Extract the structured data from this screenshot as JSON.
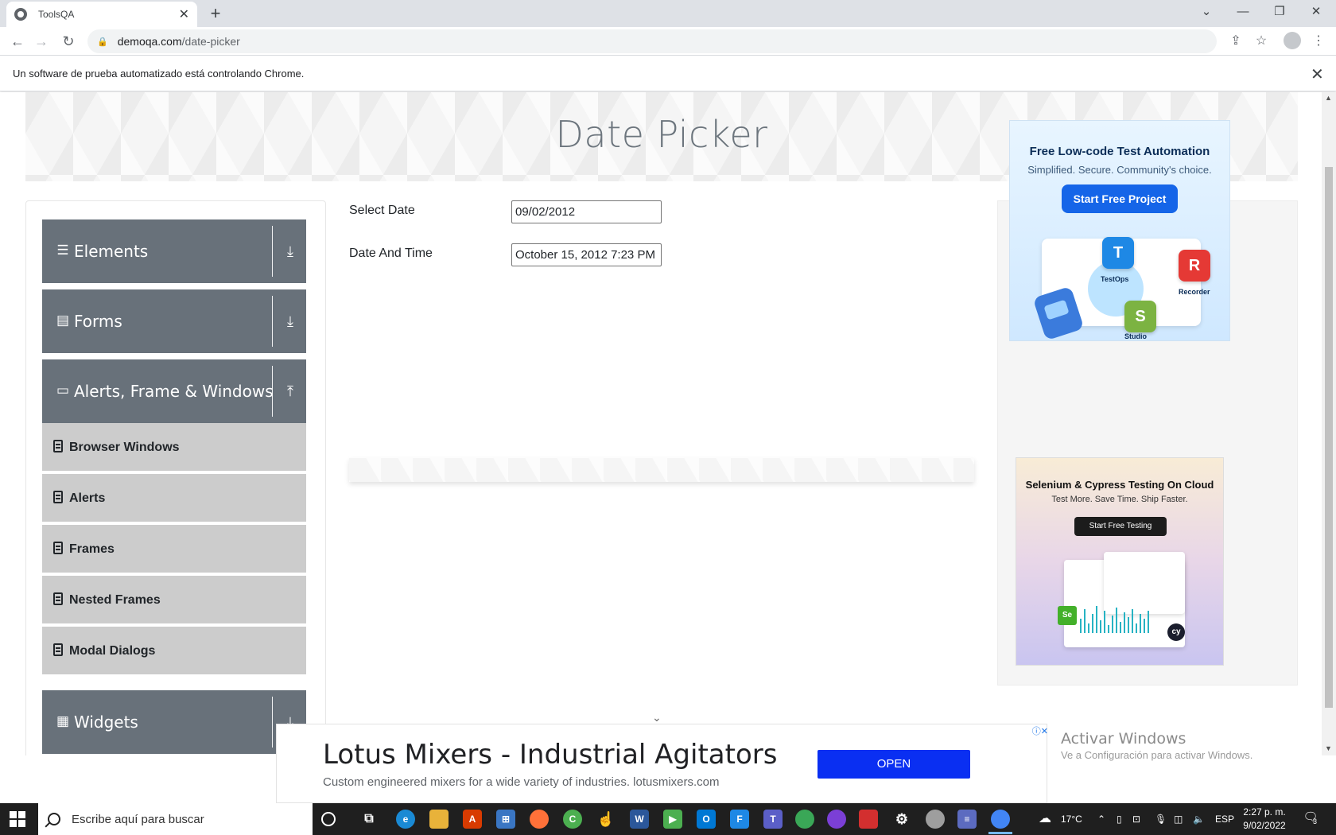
{
  "browser": {
    "tab_title": "ToolsQA",
    "url_host": "demoqa.com",
    "url_path": "/date-picker",
    "infobar_message": "Un software de prueba automatizado está controlando Chrome."
  },
  "page": {
    "title": "Date Picker",
    "sidebar": {
      "groups": [
        {
          "label": "Elements",
          "icon": "hamburger-icon",
          "state": "collapsed"
        },
        {
          "label": "Forms",
          "icon": "document-icon",
          "state": "collapsed"
        },
        {
          "label": "Alerts, Frame & Windows",
          "icon": "window-icon",
          "state": "expanded"
        },
        {
          "label": "Widgets",
          "icon": "grid-icon",
          "state": "collapsed"
        }
      ],
      "items": [
        {
          "label": "Browser Windows"
        },
        {
          "label": "Alerts"
        },
        {
          "label": "Frames"
        },
        {
          "label": "Nested Frames"
        },
        {
          "label": "Modal Dialogs"
        }
      ]
    },
    "form": {
      "select_date_label": "Select Date",
      "select_date_value": "09/02/2012",
      "date_time_label": "Date And Time",
      "date_time_value": "October 15, 2012 7:23 PM"
    },
    "ads": {
      "ad1": {
        "title": "Free Low-code Test Automation",
        "subtitle": "Simplified. Secure. Community's choice.",
        "cta": "Start Free Project",
        "labels": [
          "TestOps",
          "Recorder",
          "Studio"
        ]
      },
      "ad2": {
        "title": "Selenium & Cypress Testing On Cloud",
        "subtitle": "Test More. Save Time. Ship Faster.",
        "cta": "Start Free Testing"
      },
      "bottom": {
        "headline": "Lotus Mixers - Industrial Agitators",
        "subtext": "Custom engineered mixers for a wide variety of industries. lotusmixers.com",
        "button": "OPEN"
      }
    },
    "watermark": {
      "line1": "Activar Windows",
      "line2": "Ve a Configuración para activar Windows."
    }
  },
  "taskbar": {
    "search_placeholder": "Escribe aquí para buscar",
    "weather": "17°C",
    "language": "ESP",
    "time": "2:27 p. m.",
    "date": "9/02/2022",
    "notification_count": "3"
  }
}
